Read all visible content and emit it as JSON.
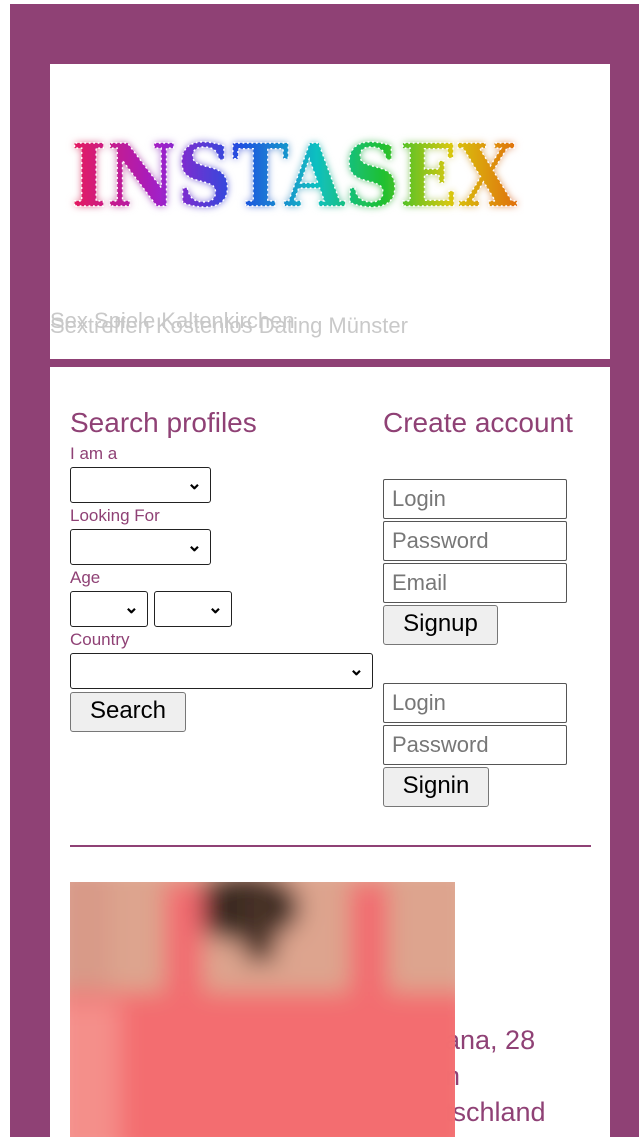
{
  "header": {
    "logo_text": "INSTASEX",
    "subtitle_back": "Sex Spiele Kaltenkirchen",
    "subtitle_front": "Sextreffen Kostenlos Dating Münster"
  },
  "search": {
    "title": "Search profiles",
    "iama_label": "I am a",
    "looking_label": "Looking For",
    "age_label": "Age",
    "country_label": "Country",
    "search_button": "Search",
    "chevron": "⌄"
  },
  "create": {
    "title": "Create account",
    "login_placeholder": "Login",
    "password_placeholder": "Password",
    "email_placeholder": "Email",
    "signup_button": "Signup"
  },
  "signin": {
    "login_placeholder": "Login",
    "password_placeholder": "Password",
    "signin_button": "Signin"
  },
  "profile": {
    "name_age": "ana, 28",
    "line2": "n",
    "line3": "tschland"
  },
  "colors": {
    "brand": "#8f4175",
    "subtitle": "#c9c9c9"
  }
}
